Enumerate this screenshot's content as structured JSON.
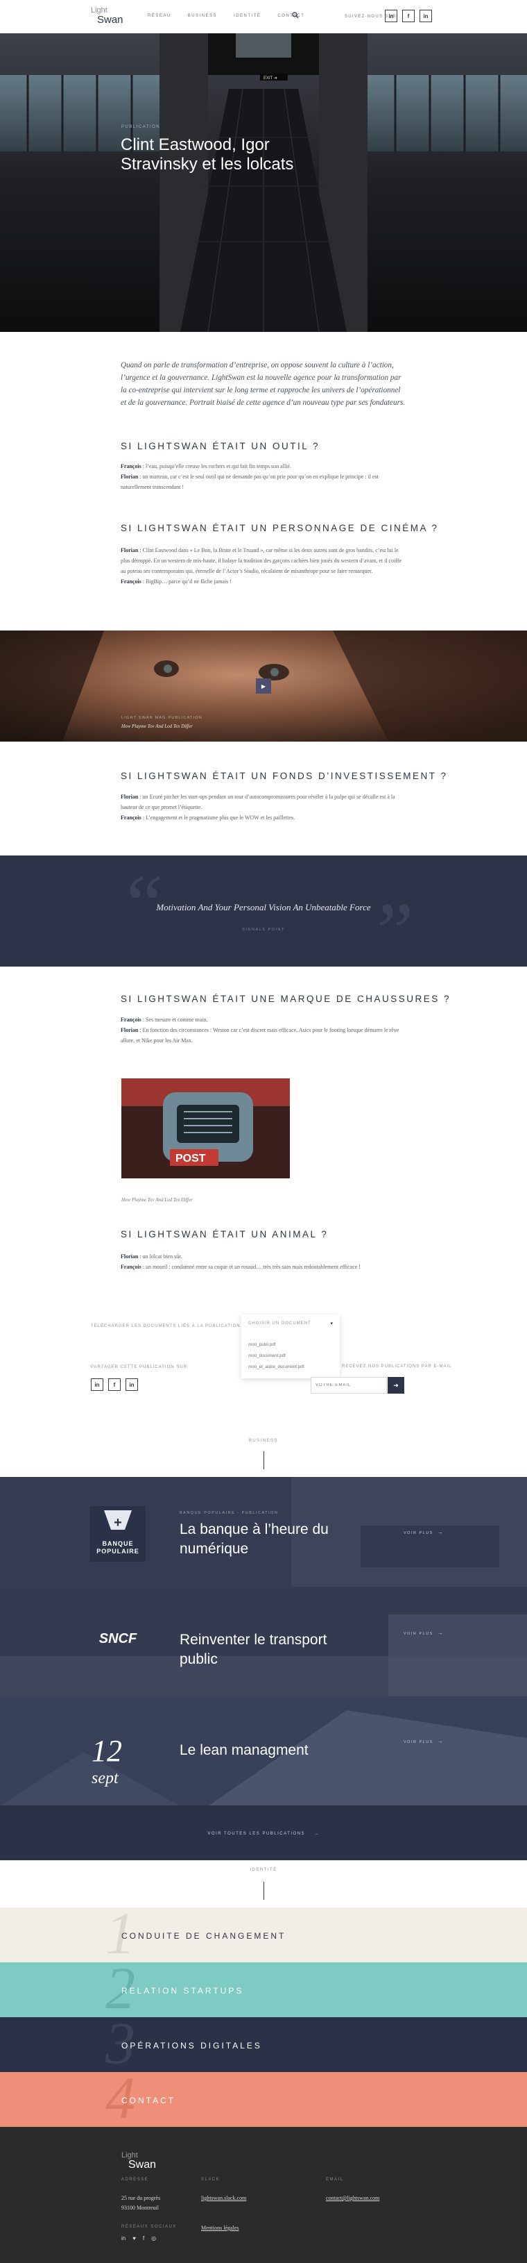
{
  "header": {
    "logo_top": "Light",
    "logo_bottom": "Swan",
    "nav": [
      "RÉSEAU",
      "BUSINESS",
      "IDENTITÉ",
      "CONTACT"
    ],
    "follow_label": "SUIVEZ-NOUS SUR",
    "social": [
      "in",
      "f",
      "in"
    ]
  },
  "hero": {
    "category": "PUBLICATION",
    "title": "Clint Eastwood, Igor Stravinsky et les lolcats",
    "sign": "EXIT ➜"
  },
  "article": {
    "lead": "Quand on parle de transformation d’entreprise, on oppose souvent la culture à l’action, l’urgence et la gouvernance. LightSwan est la nouvelle agence pour la transformation par la co-entreprise qui intervient sur le long terme et rapproche les univers de l’opérationnel et de la gouvernance. Portrait biaisé de cette agence d’un nouveau type par ses fondateurs.",
    "sections": [
      {
        "heading": "SI LIGHTSWAN ÉTAIT UN OUTIL ?",
        "lines": [
          {
            "who": "François",
            "text": " : l’eau, puisqu’elle creuse les rochers et qui fait fin temps son allié."
          },
          {
            "who": "Florian",
            "text": " : un marteau, car c’est le seul outil qui ne demande pas qu’on prie pour qu’on en explique le principe : il est naturellement transcendant !"
          }
        ]
      },
      {
        "heading": "SI LIGHTSWAN ÉTAIT UN PERSONNAGE DE CINÉMA ?",
        "lines": [
          {
            "who": "Florian",
            "text": " : Clint Eastwood dans « Le Bon, la Brute et le Truand », car même si les deux autres sont de gros bandits, c’est lui le plus détruppé. En un western de mis-haute, il balaye la tradition des garçons cachées bien joués du western d’avant, et il coiffe au poteau ses contemporains qui, éternelle de l’Actor’s Studio, récalaient de misanthrope pour se faire remarquer."
          },
          {
            "who": "François",
            "text": " : BigBip… parce qu’il ne fâche jamais !"
          }
        ]
      },
      {
        "heading": "SI LIGHTSWAN ÉTAIT UN FONDS D’INVESTISSEMENT ?",
        "lines": [
          {
            "who": "Florian",
            "text": " : un Ecuré pitcher les start-ups pendant un tour d’autocompromissures pour révéler à la pulpe qui se décalle est à la hauteur de ce que promet l’étiquette."
          },
          {
            "who": "François",
            "text": " : L’engagement et le pragmatisme plus que le WOW et les paillettes."
          }
        ]
      },
      {
        "heading": "SI LIGHTSWAN ÉTAIT UNE MARQUE DE CHAUSSURES ?",
        "lines": [
          {
            "who": "François",
            "text": " : Ses mesure et comme main."
          },
          {
            "who": "Florian",
            "text": " : En fonction des circonstances : Weston car c’est discret mais efficace, Asics pour le footing lorsque démarre le rêve allure, et Nike pour les Air Max."
          }
        ]
      },
      {
        "heading": "SI LIGHTSWAN ÉTAIT UN ANIMAL ?",
        "lines": [
          {
            "who": "Florian",
            "text": " : un lolcat bien sûr."
          },
          {
            "who": "François",
            "text": " : un mouril : condamné entre sa coque et un rosaud… très très sain mais redoutablement efficace !"
          }
        ]
      }
    ],
    "band": {
      "category": "LIGHT SWAN MAG PUBLICATION",
      "caption": "How Playme Tov And Lod Tex Differ"
    },
    "quote": {
      "text": "Motivation And Your Personal Vision An Unbeatable Force",
      "author": "SIGNALS POINT"
    },
    "inline_image": {
      "caption": "How Playme Tov And Lod Tex Differ",
      "sign": "POST"
    }
  },
  "downloads": {
    "label": "TÉLÉCHARGER LES DOCUMENTS LIÉS À LA PUBLICATION",
    "select": "CHOISIR UN DOCUMENT",
    "options": [
      "mon_publi.pdf",
      "mon_document.pdf",
      "mon_et_autre_document.pdf"
    ],
    "share_label": "PARTAGER CETTE PUBLICATION SUR",
    "share": [
      "in",
      "f",
      "in"
    ],
    "newsletter_label": "RECEVEZ NOS PUBLICATIONS PAR E-MAIL",
    "newsletter_placeholder": "VOTRE EMAIL",
    "newsletter_btn": "➜"
  },
  "business": {
    "label": "BUSINESS",
    "items": [
      {
        "category": "BANQUE POPULAIRE · PUBLICATION",
        "title": "La banque à l’heure du numérique",
        "more": "VOIR PLUS",
        "logo_line1": "BANQUE",
        "logo_line2": "POPULAIRE"
      },
      {
        "category": "",
        "title": "Reinventer le transport public",
        "more": "VOIR PLUS",
        "logo": "SNCF"
      },
      {
        "category": "",
        "title": "Le lean managment",
        "more": "VOIR PLUS",
        "date_day": "12",
        "date_month": "sept"
      }
    ],
    "all_label": "VOIR TOUTES LES PUBLICATIONS"
  },
  "identity": {
    "label": "IDENTITÉ",
    "strips": [
      {
        "num": "1",
        "label": "CONDUITE DE CHANGEMENT",
        "bg": "#f2eee7",
        "color": "#2f3445",
        "numcolor": "#b8b2a6"
      },
      {
        "num": "2",
        "label": "RELATION STARTUPS",
        "bg": "#7ecbc3",
        "color": "#ffffff",
        "numcolor": "#3b8c85"
      },
      {
        "num": "3",
        "label": "OPÉRATIONS DIGITALES",
        "bg": "#2b3146",
        "color": "#ffffff",
        "numcolor": "#5c6277"
      },
      {
        "num": "4",
        "label": "CONTACT",
        "bg": "#f08f79",
        "color": "#ffffff",
        "numcolor": "#b8553f"
      }
    ]
  },
  "footer": {
    "logo_top": "Light",
    "logo_bottom": "Swan",
    "address_h": "ADRESSE",
    "address": [
      "25 rue du progrès",
      "93100 Montreuil"
    ],
    "slack_h": "SLACK",
    "slack": "lightswan.slack.com",
    "email_h": "EMAIL",
    "email": "contact@lightswan.com",
    "social_h": "RÉSEAUX SOCIAUX",
    "social": [
      "in",
      "♥",
      "f",
      "◎"
    ],
    "legal": "Mentions légales"
  }
}
